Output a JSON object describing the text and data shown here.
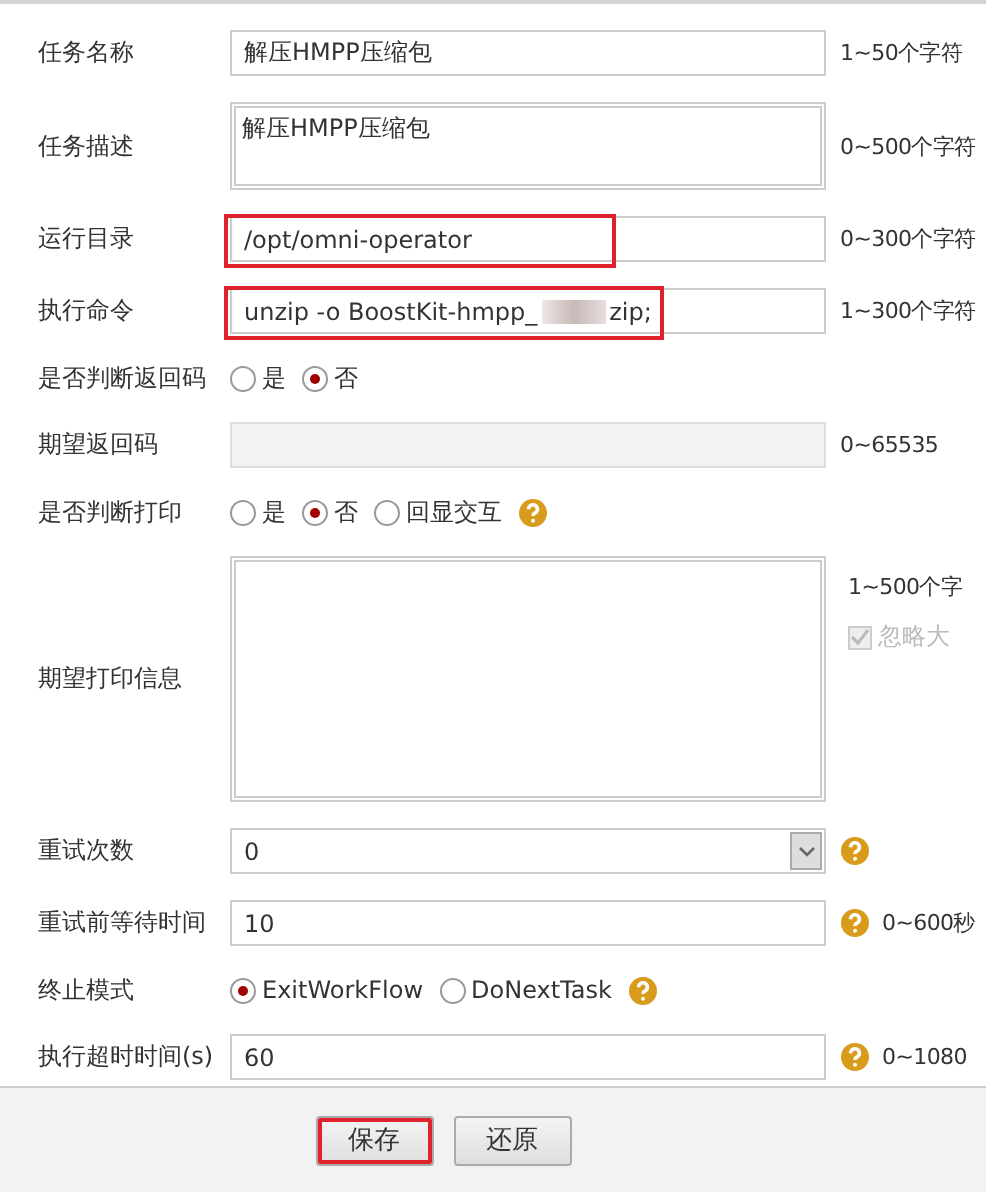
{
  "form": {
    "rows": [
      {
        "kind": "text",
        "label": "任务名称",
        "value": "解压HMPP压缩包",
        "hint": "1~50个字符"
      },
      {
        "kind": "textarea",
        "label": "任务描述",
        "value": "解压HMPP压缩包",
        "hint": "0~500个字符"
      },
      {
        "kind": "text",
        "label": "运行目录",
        "value": "/opt/omni-operator",
        "hint": "0~300个字符",
        "highlighted": true
      },
      {
        "kind": "redacted",
        "label": "执行命令",
        "value_parts": [
          "unzip -o BoostKit-hmpp_",
          "zip;"
        ],
        "hint": "1~300个字符",
        "highlighted": true
      },
      {
        "kind": "radio",
        "label": "是否判断返回码",
        "options": [
          {
            "label": "是",
            "selected": false
          },
          {
            "label": "否",
            "selected": true
          }
        ]
      },
      {
        "kind": "disabled",
        "label": "期望返回码",
        "hint": "0~65535"
      },
      {
        "kind": "radio",
        "label": "是否判断打印",
        "options": [
          {
            "label": "是",
            "selected": false
          },
          {
            "label": "否",
            "selected": true
          },
          {
            "label": "回显交互",
            "selected": false
          }
        ],
        "help": true
      },
      {
        "kind": "bigtext",
        "label": "期望打印信息",
        "hint": "1~500个字",
        "checkbox": {
          "label": "忽略大",
          "checked": true,
          "disabled": true
        }
      },
      {
        "kind": "select",
        "label": "重试次数",
        "value": "0",
        "help": true
      },
      {
        "kind": "text",
        "label": "重试前等待时间",
        "value": "10",
        "hint": "0~600秒",
        "help": true
      },
      {
        "kind": "radio",
        "label": "终止模式",
        "options": [
          {
            "label": "ExitWorkFlow",
            "selected": true
          },
          {
            "label": "DoNextTask",
            "selected": false
          }
        ],
        "help": true
      },
      {
        "kind": "text",
        "label": "执行超时时间(s)",
        "value": "60",
        "hint": "0~1080",
        "help": true
      }
    ]
  },
  "buttons": [
    {
      "label": "保存",
      "highlighted": true
    },
    {
      "label": "还原",
      "highlighted": false
    }
  ]
}
